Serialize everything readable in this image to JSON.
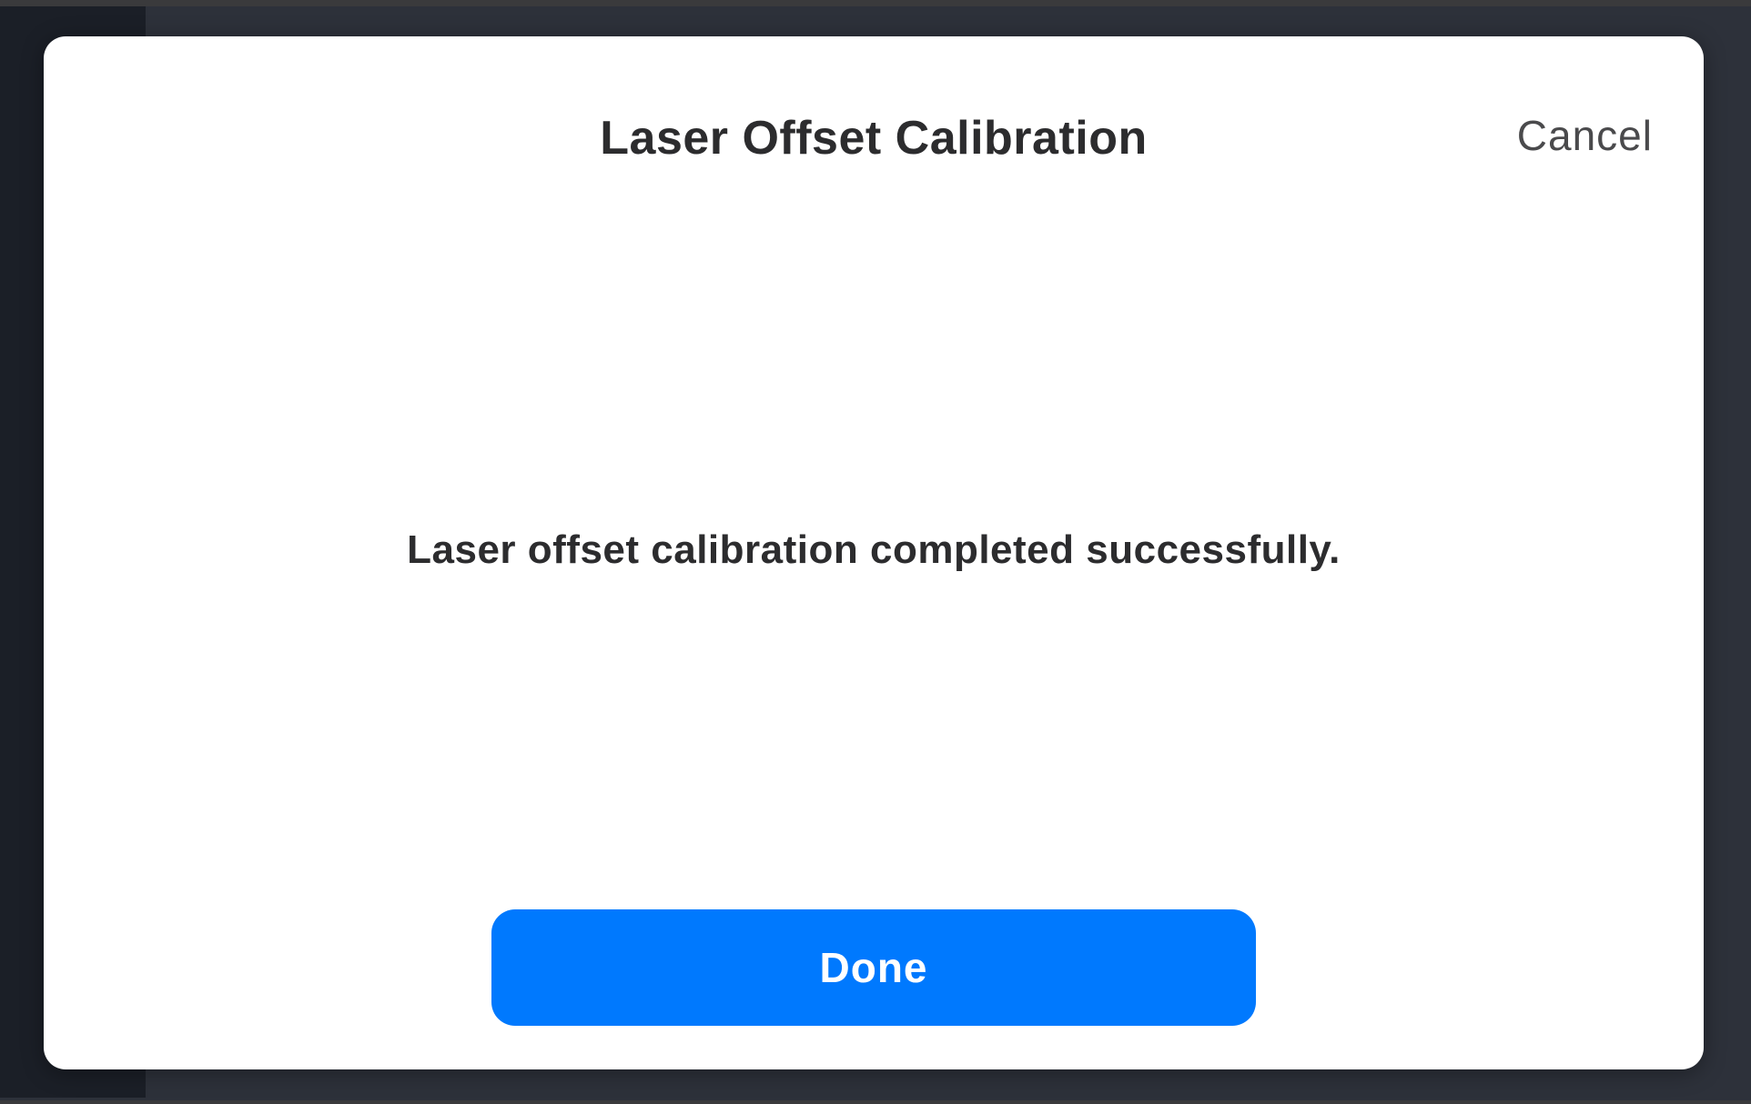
{
  "dialog": {
    "title": "Laser Offset Calibration",
    "cancel_label": "Cancel",
    "message": "Laser offset calibration completed successfully.",
    "done_label": "Done"
  },
  "colors": {
    "primary_button": "#0079fe",
    "backdrop": "#2d313a",
    "modal_background": "#ffffff",
    "text": "#2c2c2e"
  }
}
